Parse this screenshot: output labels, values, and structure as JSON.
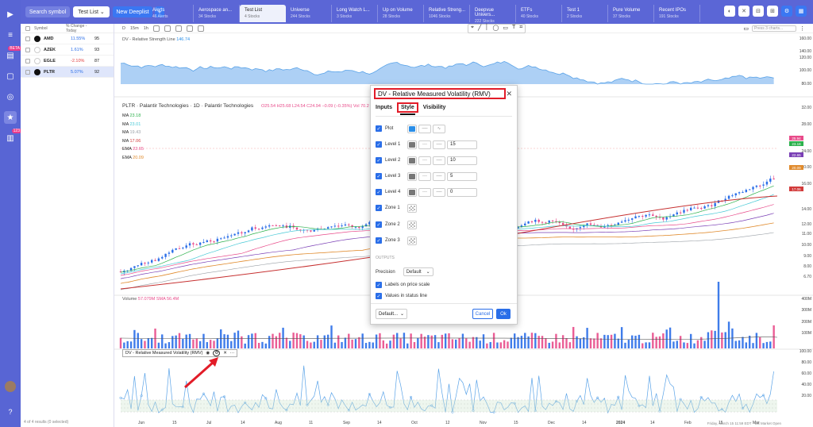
{
  "topbar": {
    "search_label": "Search symbol",
    "list_label": "Test List",
    "new_deeplist": "New Deeplist",
    "add": "+",
    "tabs": [
      {
        "title": "Alerts",
        "sub": "46 Alerts"
      },
      {
        "title": "Aerospace an...",
        "sub": "34 Stocks"
      },
      {
        "title": "Test List",
        "sub": "4 Stocks"
      },
      {
        "title": "Universe",
        "sub": "244 Stocks"
      },
      {
        "title": "Long Watch L...",
        "sub": "3 Stocks"
      },
      {
        "title": "Up on Volume",
        "sub": "28 Stocks"
      },
      {
        "title": "Relative Streng...",
        "sub": "1046 Stocks"
      },
      {
        "title": "Deepvue Univers...",
        "sub": "222 Stocks"
      },
      {
        "title": "ETFs",
        "sub": "40 Stocks"
      },
      {
        "title": "Test 1",
        "sub": "2 Stocks"
      },
      {
        "title": "Pure Volume",
        "sub": "37 Stocks"
      },
      {
        "title": "Recent IPOs",
        "sub": "191 Stocks"
      }
    ]
  },
  "rail": {
    "badge_one": "BETA",
    "badge_two": "123"
  },
  "watchlist": {
    "headers": {
      "symbol": "Symbol",
      "change": "% Change - Today"
    },
    "rows": [
      {
        "symbol": "AMD",
        "change": "11.55%",
        "value": "95",
        "dir": "pos"
      },
      {
        "symbol": "AZEK",
        "change": "1.61%",
        "value": "93",
        "dir": "pos"
      },
      {
        "symbol": "EGLE",
        "change": "-2.10%",
        "value": "87",
        "dir": "neg"
      },
      {
        "symbol": "PLTR",
        "change": "5.07%",
        "value": "92",
        "dir": "pos"
      }
    ],
    "footer": "4 of 4 results (0 selected)"
  },
  "chart": {
    "toolbar": {
      "interval_d": "D",
      "interval_15": "15m",
      "interval_1h": "1h",
      "compare": "Press 3 charts..."
    },
    "rs_label": "DV - Relative Strength Line",
    "rs_value": "146.74",
    "title": "PLTR · Palantir Technologies · 1D · Palantir Technologies",
    "ohlc": "O25.54  H25.68  L24.54  C24.94  −0.09 (−0.35%)  Vol 70.2",
    "ma": [
      {
        "name": "MA",
        "value": "23.18",
        "color": "#2cb14c"
      },
      {
        "name": "MA",
        "value": "23.01",
        "color": "#46c9d6"
      },
      {
        "name": "MA",
        "value": "19.43",
        "color": "#9aa0a6"
      },
      {
        "name": "MA",
        "value": "17.06",
        "color": "#d23a3a"
      },
      {
        "name": "EMA",
        "value": "22.65",
        "color": "#e84b8a"
      },
      {
        "name": "EMA",
        "value": "20.09",
        "color": "#e08a2c"
      }
    ],
    "price_axis": [
      "32.00",
      "28.00",
      "24.00",
      "20.00",
      "16.00",
      "14.00",
      "12.00",
      "11.00",
      "10.00",
      "9.00",
      "8.00",
      "6.70"
    ],
    "rs_axis": [
      "160.00",
      "140.00",
      "120.00",
      "100.00",
      "80.00"
    ],
    "price_tags": [
      {
        "value": "25.94",
        "color": "#e84b8a"
      },
      {
        "value": "23.18",
        "color": "#2cb14c"
      },
      {
        "value": "22.65",
        "color": "#7a3fb5"
      },
      {
        "value": "20.09",
        "color": "#e08a2c"
      },
      {
        "value": "17.06",
        "color": "#d23a3a"
      }
    ],
    "volume_label": "Volume",
    "volume_value": "57.079M   SMA 56.4M",
    "volume_axis": [
      "400M",
      "300M",
      "200M",
      "100M"
    ],
    "rmv_label": "DV - Relative Measured Volatility (RMV)",
    "rmv_axis": [
      "100.00",
      "80.00",
      "60.00",
      "40.00",
      "20.00"
    ],
    "dates": [
      "Jun",
      "15",
      "Jul",
      "14",
      "Aug",
      "11",
      "Sep",
      "14",
      "Oct",
      "12",
      "Nov",
      "15",
      "Dec",
      "14",
      "2024",
      "14",
      "Feb",
      "15",
      "Mar"
    ],
    "status": "Friday, March 15 11:59 EDT · US Market Open"
  },
  "dialog": {
    "title": "DV - Relative Measured Volatility (RMV)",
    "tabs": {
      "inputs": "Inputs",
      "style": "Style",
      "visibility": "Visibility"
    },
    "rows": [
      {
        "name": "Plot",
        "color": "#2a8ee8",
        "value": ""
      },
      {
        "name": "Level 1",
        "color": "#777777",
        "value": "15"
      },
      {
        "name": "Level 2",
        "color": "#777777",
        "value": "10"
      },
      {
        "name": "Level 3",
        "color": "#777777",
        "value": "5"
      },
      {
        "name": "Level 4",
        "color": "#777777",
        "value": "0"
      }
    ],
    "zones": [
      "Zone 1",
      "Zone 2",
      "Zone 3"
    ],
    "outputs_label": "OUTPUTS",
    "precision_label": "Precision",
    "precision_value": "Default",
    "labels_on_scale": "Labels on price scale",
    "values_in_status": "Values in status line",
    "defaults": "Default...",
    "cancel": "Cancel",
    "ok": "Ok"
  }
}
